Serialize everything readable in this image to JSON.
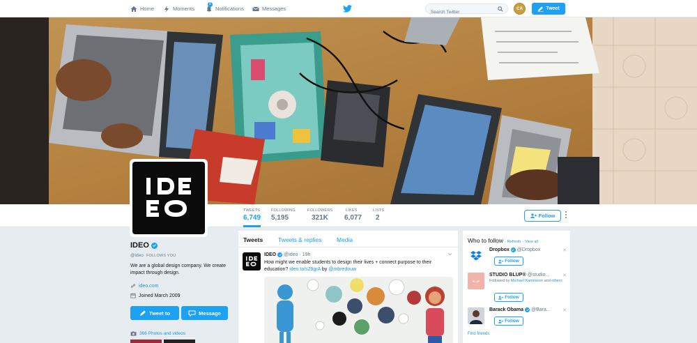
{
  "nav": {
    "home": "Home",
    "moments": "Moments",
    "notifications": "Notifications",
    "notif_count": "8",
    "messages": "Messages",
    "search_placeholder": "Search Twitter",
    "avatar_initials": "CA",
    "tweet_button": "Tweet"
  },
  "stats": [
    {
      "label": "TWEETS",
      "value": "6,749"
    },
    {
      "label": "FOLLOWING",
      "value": "5,195"
    },
    {
      "label": "FOLLOWERS",
      "value": "321K"
    },
    {
      "label": "LIKES",
      "value": "6,077"
    },
    {
      "label": "LISTS",
      "value": "2"
    }
  ],
  "profile": {
    "follow_button": "Follow",
    "logo_line1": "IDE",
    "logo_line2": "EO",
    "name": "IDEO",
    "handle": "@ideo",
    "follows_you": "FOLLOWS YOU",
    "bio": "We are a global design company. We create impact through design.",
    "website": "ideo.com",
    "joined": "Joined March 2009",
    "tweet_to": "Tweet to",
    "message": "Message",
    "photos": "366 Photos and videos"
  },
  "timeline": {
    "tabs": [
      "Tweets",
      "Tweets & replies",
      "Media"
    ],
    "tweet": {
      "name": "IDEO",
      "handle": "@ideo",
      "time": "· 19h",
      "text_plain": "How might we enable students to design their lives + connect purpose to their education? ",
      "link": "ideo.to/s29grA",
      "by": " by ",
      "mention": "@mbredouw"
    }
  },
  "who_to_follow": {
    "title": "Who to follow",
    "sep1": "·",
    "refresh": "Refresh",
    "sep2": "·",
    "view_all": "View all",
    "follow_label": "Follow",
    "suggestions": [
      {
        "name": "Dropbox",
        "handle": "@Dropbox"
      },
      {
        "name": "STUDIO BLUP®",
        "handle": "@studio...",
        "followed_by_prefix": "Followed by ",
        "followed_by_name": "Michael Kammerer",
        "followed_by_and": " and ",
        "followed_by_others": "others"
      },
      {
        "name": "Barack Obama",
        "handle": "@Bara..."
      }
    ],
    "find_friends": "Find friends"
  },
  "colors": {
    "accent": "#1da1f2",
    "link": "#1b95e0",
    "background": "#e6ecf0"
  }
}
